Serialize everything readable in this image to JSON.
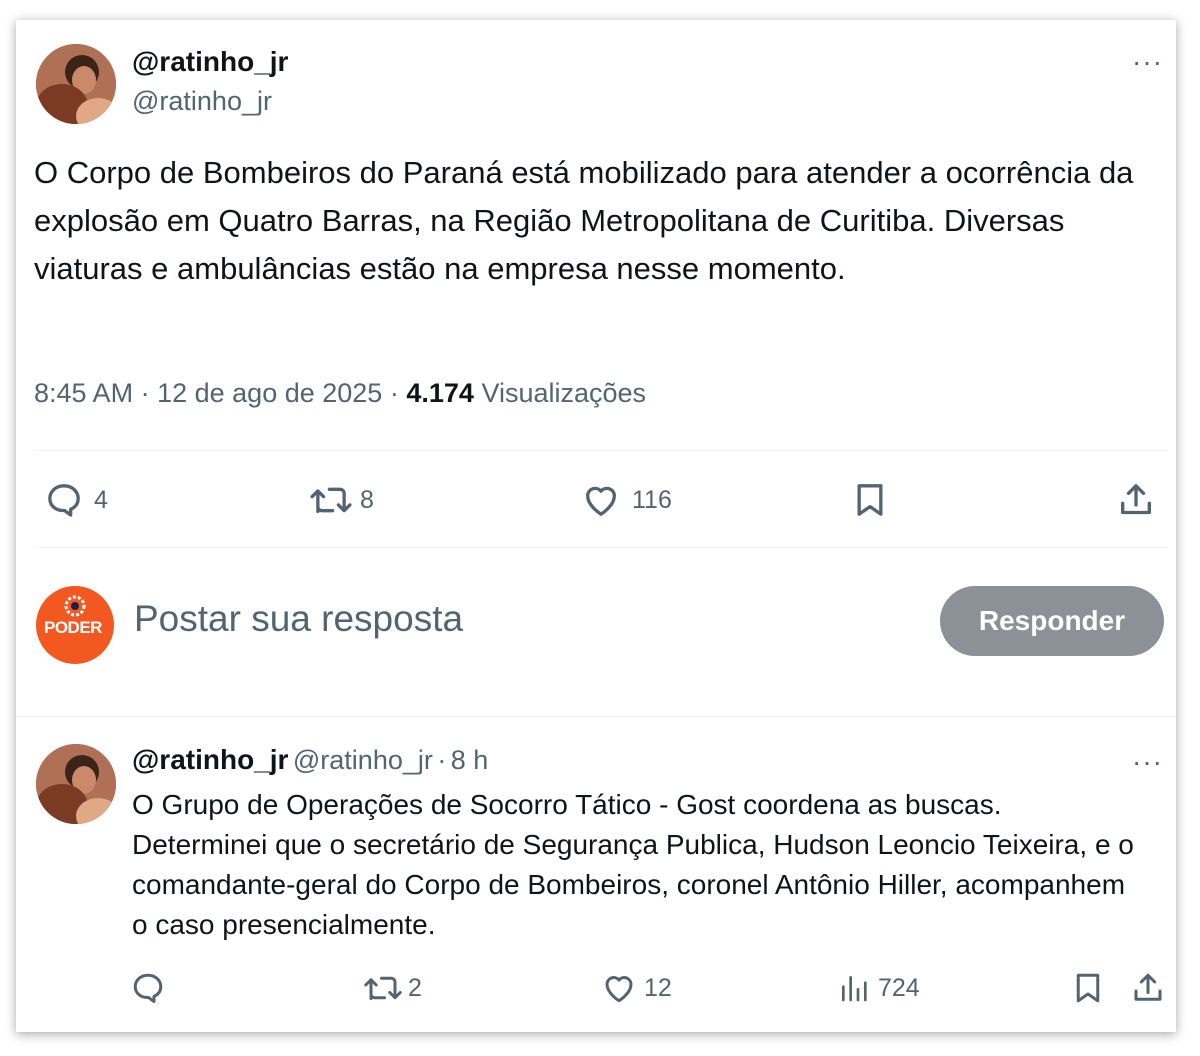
{
  "tweet": {
    "display_name": "@ratinho_jr",
    "handle": "@ratinho_jr",
    "more_label": "···",
    "text": "O Corpo de Bombeiros do Paraná está mobilizado para atender a ocorrência da explosão em Quatro Barras, na Região Metropolitana de Curitiba. Diversas viaturas e ambulâncias estão na empresa nesse momento.",
    "time": "8:45 AM",
    "separator": "·",
    "date": "12 de ago de 2025",
    "views_count": "4.174",
    "views_label": "Visualizações",
    "actions": {
      "reply_count": "4",
      "retweet_count": "8",
      "like_count": "116"
    }
  },
  "compose": {
    "avatar_text": "PODER",
    "placeholder": "Postar sua resposta",
    "button_label": "Responder"
  },
  "reply": {
    "display_name": "@ratinho_jr",
    "handle": "@ratinho_jr",
    "dot": "·",
    "time_ago": "8 h",
    "more_label": "···",
    "text": "O Grupo de Operações de Socorro Tático - Gost coordena as buscas. Determinei que o secretário de Segurança Publica, Hudson Leoncio Teixeira, e o comandante-geral do Corpo de Bombeiros, coronel Antônio Hiller, acompanhem o caso presencialmente.",
    "actions": {
      "retweet_count": "2",
      "like_count": "12",
      "views_count": "724"
    }
  },
  "colors": {
    "secondary_text": "#536471",
    "button_disabled": "#8b9196",
    "poder_orange": "#f2581f"
  }
}
